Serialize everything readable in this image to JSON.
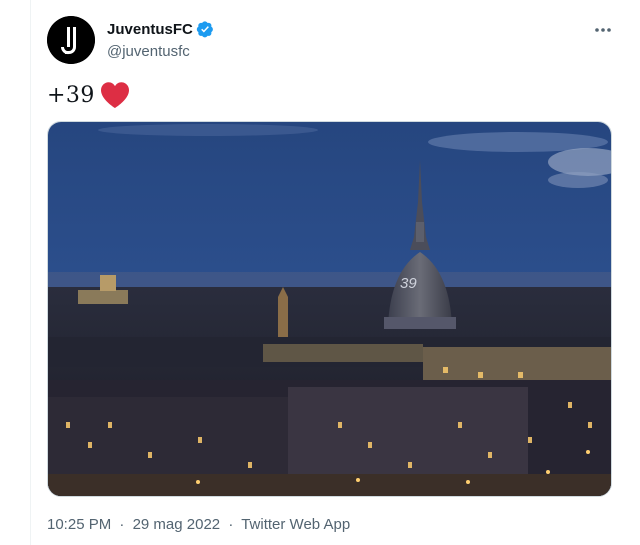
{
  "tweet": {
    "author": {
      "display_name": "JuventusFC",
      "handle": "@juventusfc",
      "verified": true,
      "avatar_icon": "juventus-logo-icon"
    },
    "text": "+39",
    "emoji_icon": "red-heart-icon",
    "media": {
      "type": "photo",
      "dome_text": "39"
    },
    "timestamp": {
      "time": "10:25 PM",
      "separator": "·",
      "date": "29 mag 2022",
      "source": "Twitter Web App"
    }
  },
  "colors": {
    "text_primary": "#0f1419",
    "text_secondary": "#536471",
    "verified": "#1d9bf0",
    "heart": "#e0245e",
    "border": "#cfd9de"
  }
}
